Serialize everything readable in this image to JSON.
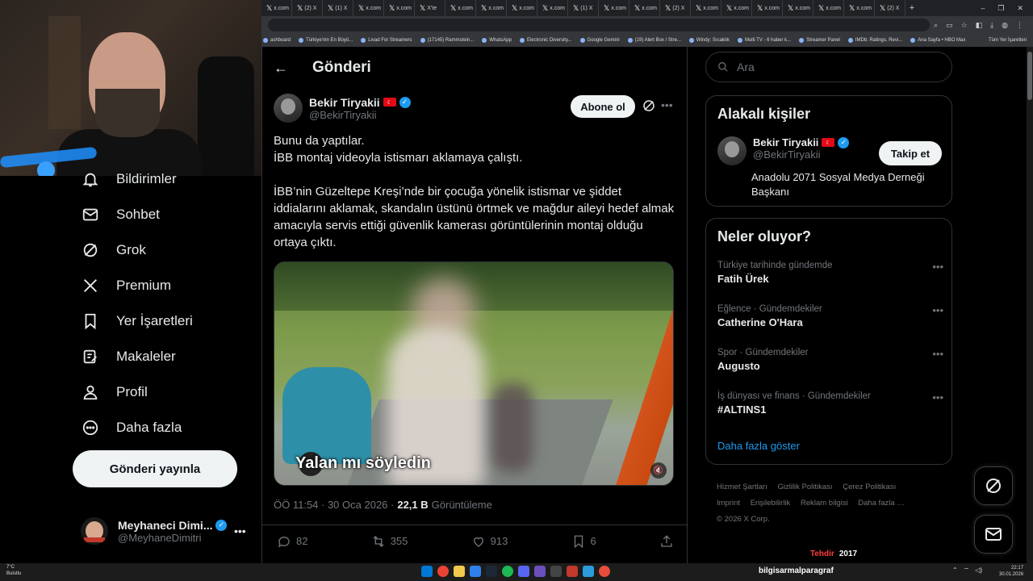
{
  "browser": {
    "tabs": [
      "x.com",
      "(2) X",
      "(1) X",
      "x.com",
      "x.com",
      "X'te",
      "x.com",
      "x.com",
      "x.com",
      "x.com",
      "(1) X",
      "x.com",
      "x.com",
      "(2) X",
      "x.com",
      "x.com",
      "x.com",
      "x.com",
      "x.com",
      "x.com",
      "(2) X"
    ],
    "new_tab": "+",
    "bookmarks": [
      "ashboard",
      "Türkiye'nin En Büyü...",
      "Livad For Streamers",
      "(17145) Rammstein...",
      "WhatsApp",
      "Electronic Diversity...",
      "Google Gemini",
      "(19) Alert Box / Stre...",
      "Windy: Sıcaklık",
      "Multi TV - 6 haber k...",
      "Streamer Panel",
      "IMDb: Ratings, Revi...",
      "Ana Sayfa • HBO Max"
    ],
    "all_bookmarks": "Tüm Yer İşaretleri"
  },
  "leftnav": {
    "items": [
      {
        "label": "Bildirimler",
        "icon": "bell-icon"
      },
      {
        "label": "Sohbet",
        "icon": "mail-icon"
      },
      {
        "label": "Grok",
        "icon": "grok-icon"
      },
      {
        "label": "Premium",
        "icon": "x-logo-icon"
      },
      {
        "label": "Yer İşaretleri",
        "icon": "bookmark-icon"
      },
      {
        "label": "Makaleler",
        "icon": "article-icon"
      },
      {
        "label": "Profil",
        "icon": "person-icon"
      },
      {
        "label": "Daha fazla",
        "icon": "more-circle-icon"
      }
    ],
    "post_button": "Gönderi yayınla",
    "account": {
      "name": "Meyhaneci Dimi...",
      "handle": "@MeyhaneDimitri",
      "more": "•••"
    }
  },
  "main": {
    "header_title": "Gönderi",
    "author": {
      "name": "Bekir Tiryakii",
      "handle": "@BekirTiryakii"
    },
    "subscribe_button": "Abone ol",
    "more": "•••",
    "text": {
      "line1": "Bunu da yaptılar.",
      "line2": "İBB montaj videoyla istismarı aklamaya çalıştı.",
      "para2": "İBB’nin Güzeltepe Kreşi’nde bir çocuğa yönelik istismar ve şiddet iddialarını aklamak, skandalın üstünü örtmek ve mağdur aileyi hedef almak amacıyla servis ettiği güvenlik kamerası görüntülerinin montaj olduğu ortaya çıktı."
    },
    "video_caption": "Yalan mı söyledin",
    "meta": {
      "time": "ÖÖ 11:54 · 30 Oca 2026 ·",
      "views": "22,1 B",
      "views_label": "Görüntüleme"
    },
    "metrics": {
      "replies": "82",
      "reposts": "355",
      "likes": "913",
      "bookmarks": "6"
    }
  },
  "right": {
    "search_placeholder": "Ara",
    "related": {
      "title": "Alakalı kişiler",
      "name": "Bekir Tiryakii",
      "handle": "@BekirTiryakii",
      "bio": "Anadolu 2071 Sosyal Medya Derneği Başkanı",
      "follow": "Takip et"
    },
    "trends": {
      "title": "Neler oluyor?",
      "items": [
        {
          "context": "Türkiye tarihinde gündemde",
          "title": "Fatih Ürek"
        },
        {
          "context": "Eğlence · Gündemdekiler",
          "title": "Catherine O'Hara"
        },
        {
          "context": "Spor · Gündemdekiler",
          "title": "Augusto"
        },
        {
          "context": "İş dünyası ve finans · Gündemdekiler",
          "title": "#ALTINS1"
        }
      ],
      "show_more": "Daha fazla göster",
      "dots": "•••"
    },
    "footer": [
      "Hizmet Şartları",
      "Gizlilik Politikası",
      "Çerez Politikası",
      "Imprint",
      "Erişilebilirlik",
      "Reklam bilgisi",
      "Daha fazla …",
      "© 2026 X Corp."
    ]
  },
  "overlay": {
    "left": "Tehdir",
    "right": "2017"
  },
  "taskbar": {
    "temp": "7°C",
    "weather": "Bulutlu",
    "user": "bilgisarmalparagraf",
    "time": "22:17",
    "date": "30.01.2026"
  },
  "colors": {
    "accent": "#1d9bf0",
    "background": "#000000",
    "border": "#2f3336",
    "muted": "#71767b"
  }
}
